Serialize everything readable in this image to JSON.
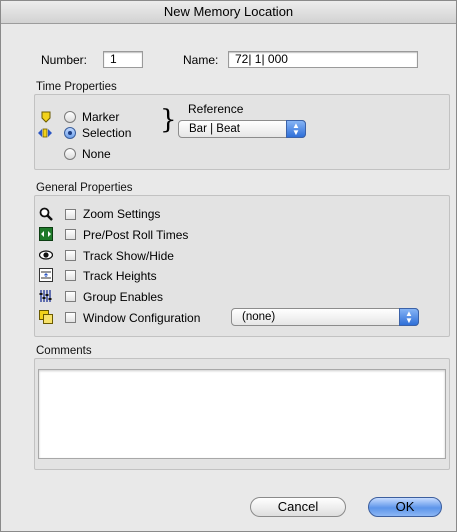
{
  "window": {
    "title": "New Memory Location"
  },
  "location": {
    "number_label": "Number:",
    "number_value": "1",
    "name_label": "Name:",
    "name_value": "72| 1| 000"
  },
  "time_properties": {
    "heading": "Time Properties",
    "options": [
      {
        "label": "Marker",
        "selected": false,
        "icon": "marker-icon"
      },
      {
        "label": "Selection",
        "selected": true,
        "icon": "selection-icon"
      },
      {
        "label": "None",
        "selected": false,
        "icon": ""
      }
    ],
    "reference_label": "Reference",
    "reference_value": "Bar | Beat"
  },
  "general_properties": {
    "heading": "General Properties",
    "items": [
      {
        "label": "Zoom Settings",
        "icon": "magnifier-icon",
        "checked": false
      },
      {
        "label": "Pre/Post Roll Times",
        "icon": "preroll-icon",
        "checked": false
      },
      {
        "label": "Track Show/Hide",
        "icon": "eye-icon",
        "checked": false
      },
      {
        "label": "Track Heights",
        "icon": "track-heights-icon",
        "checked": false
      },
      {
        "label": "Group Enables",
        "icon": "group-enables-icon",
        "checked": false
      },
      {
        "label": "Window Configuration",
        "icon": "window-config-icon",
        "checked": false
      }
    ],
    "window_config_value": "(none)"
  },
  "comments": {
    "heading": "Comments",
    "value": ""
  },
  "buttons": {
    "cancel": "Cancel",
    "ok": "OK"
  },
  "colors": {
    "accent": "#5d95ea",
    "window_bg": "#e9e9e9"
  }
}
